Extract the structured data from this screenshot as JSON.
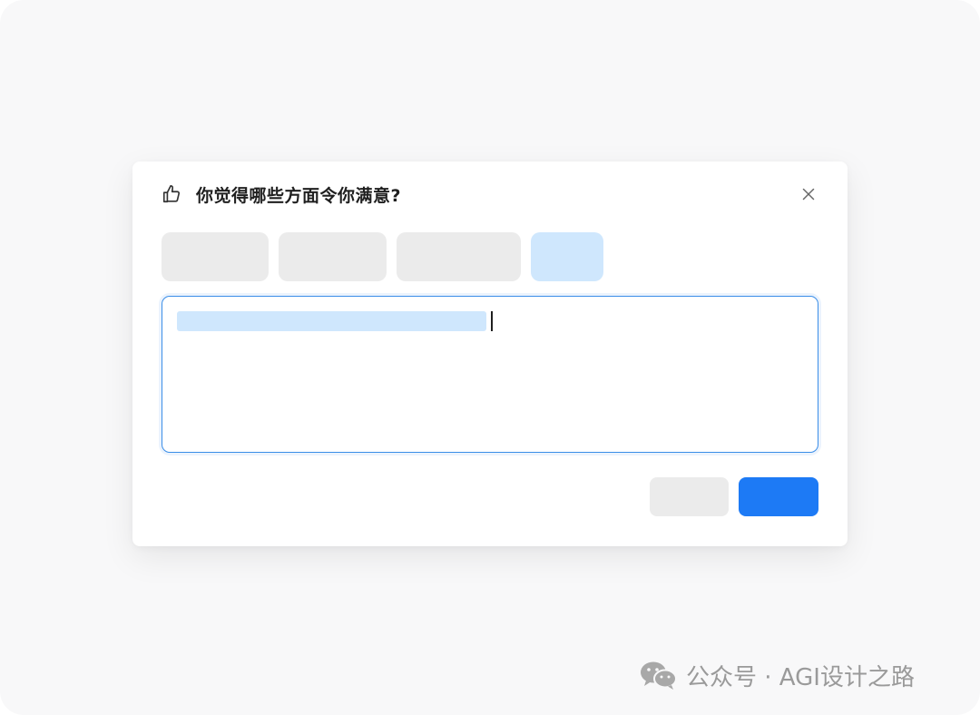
{
  "dialog": {
    "title": "你觉得哪些方面令你满意?",
    "header_icon": "thumbs-up-icon",
    "close_icon": "close-icon",
    "tags": [
      {
        "selected": false
      },
      {
        "selected": false
      },
      {
        "selected": false
      },
      {
        "selected": true
      }
    ],
    "feedback_input": {
      "has_selection": true,
      "focused": true
    },
    "buttons": {
      "cancel": {
        "label": ""
      },
      "submit": {
        "label": ""
      }
    }
  },
  "watermark": {
    "icon": "wechat-icon",
    "text": "公众号 · AGI设计之路"
  },
  "colors": {
    "primary": "#1d7af5",
    "selection": "#cfe7fd",
    "placeholder_block": "#ebebeb",
    "input_border": "#3b8ee8"
  }
}
